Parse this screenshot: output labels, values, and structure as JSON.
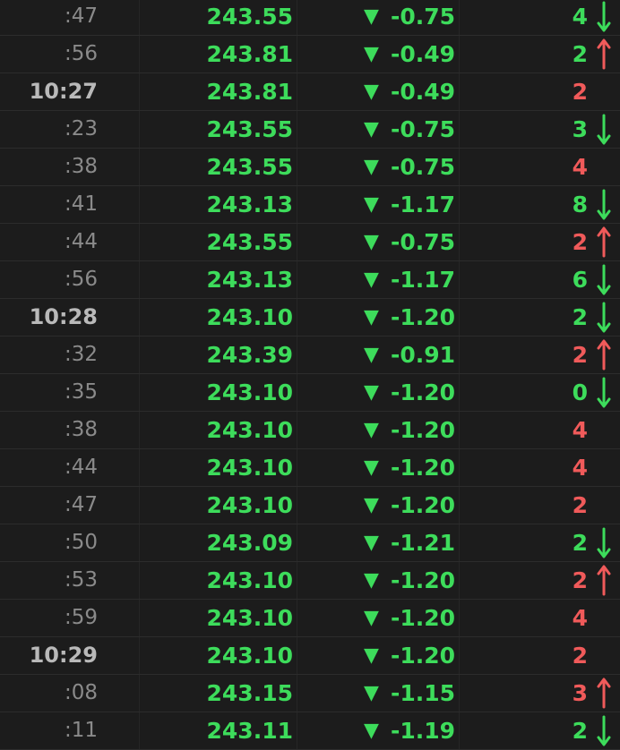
{
  "colors": {
    "background": "#1c1c1c",
    "up": "#3ddc5b",
    "down": "#f05a5a",
    "time_minor": "#8a8a8a",
    "time_major": "#b9b9b9"
  },
  "icons": {
    "change": "down-triangle-icon",
    "tick_up": "arrow-up-icon",
    "tick_down": "arrow-down-icon"
  },
  "rows": [
    {
      "time": ":47",
      "major": false,
      "price": "243.55",
      "change_arrow": "▼",
      "change": "-0.75",
      "volume": "4",
      "volume_color": "green",
      "tick": "down"
    },
    {
      "time": ":56",
      "major": false,
      "price": "243.81",
      "change_arrow": "▼",
      "change": "-0.49",
      "volume": "2",
      "volume_color": "green",
      "tick": "up"
    },
    {
      "time": "10:27",
      "major": true,
      "price": "243.81",
      "change_arrow": "▼",
      "change": "-0.49",
      "volume": "2",
      "volume_color": "red",
      "tick": "none"
    },
    {
      "time": ":23",
      "major": false,
      "price": "243.55",
      "change_arrow": "▼",
      "change": "-0.75",
      "volume": "3",
      "volume_color": "green",
      "tick": "down"
    },
    {
      "time": ":38",
      "major": false,
      "price": "243.55",
      "change_arrow": "▼",
      "change": "-0.75",
      "volume": "4",
      "volume_color": "red",
      "tick": "none"
    },
    {
      "time": ":41",
      "major": false,
      "price": "243.13",
      "change_arrow": "▼",
      "change": "-1.17",
      "volume": "8",
      "volume_color": "green",
      "tick": "down"
    },
    {
      "time": ":44",
      "major": false,
      "price": "243.55",
      "change_arrow": "▼",
      "change": "-0.75",
      "volume": "2",
      "volume_color": "red",
      "tick": "up"
    },
    {
      "time": ":56",
      "major": false,
      "price": "243.13",
      "change_arrow": "▼",
      "change": "-1.17",
      "volume": "6",
      "volume_color": "green",
      "tick": "down"
    },
    {
      "time": "10:28",
      "major": true,
      "price": "243.10",
      "change_arrow": "▼",
      "change": "-1.20",
      "volume": "2",
      "volume_color": "green",
      "tick": "down"
    },
    {
      "time": ":32",
      "major": false,
      "price": "243.39",
      "change_arrow": "▼",
      "change": "-0.91",
      "volume": "2",
      "volume_color": "red",
      "tick": "up"
    },
    {
      "time": ":35",
      "major": false,
      "price": "243.10",
      "change_arrow": "▼",
      "change": "-1.20",
      "volume": "0",
      "volume_color": "green",
      "tick": "down"
    },
    {
      "time": ":38",
      "major": false,
      "price": "243.10",
      "change_arrow": "▼",
      "change": "-1.20",
      "volume": "4",
      "volume_color": "red",
      "tick": "none"
    },
    {
      "time": ":44",
      "major": false,
      "price": "243.10",
      "change_arrow": "▼",
      "change": "-1.20",
      "volume": "4",
      "volume_color": "red",
      "tick": "none"
    },
    {
      "time": ":47",
      "major": false,
      "price": "243.10",
      "change_arrow": "▼",
      "change": "-1.20",
      "volume": "2",
      "volume_color": "red",
      "tick": "none"
    },
    {
      "time": ":50",
      "major": false,
      "price": "243.09",
      "change_arrow": "▼",
      "change": "-1.21",
      "volume": "2",
      "volume_color": "green",
      "tick": "down"
    },
    {
      "time": ":53",
      "major": false,
      "price": "243.10",
      "change_arrow": "▼",
      "change": "-1.20",
      "volume": "2",
      "volume_color": "red",
      "tick": "up"
    },
    {
      "time": ":59",
      "major": false,
      "price": "243.10",
      "change_arrow": "▼",
      "change": "-1.20",
      "volume": "4",
      "volume_color": "red",
      "tick": "none"
    },
    {
      "time": "10:29",
      "major": true,
      "price": "243.10",
      "change_arrow": "▼",
      "change": "-1.20",
      "volume": "2",
      "volume_color": "red",
      "tick": "none"
    },
    {
      "time": ":08",
      "major": false,
      "price": "243.15",
      "change_arrow": "▼",
      "change": "-1.15",
      "volume": "3",
      "volume_color": "red",
      "tick": "up"
    },
    {
      "time": ":11",
      "major": false,
      "price": "243.11",
      "change_arrow": "▼",
      "change": "-1.19",
      "volume": "2",
      "volume_color": "green",
      "tick": "down"
    }
  ]
}
